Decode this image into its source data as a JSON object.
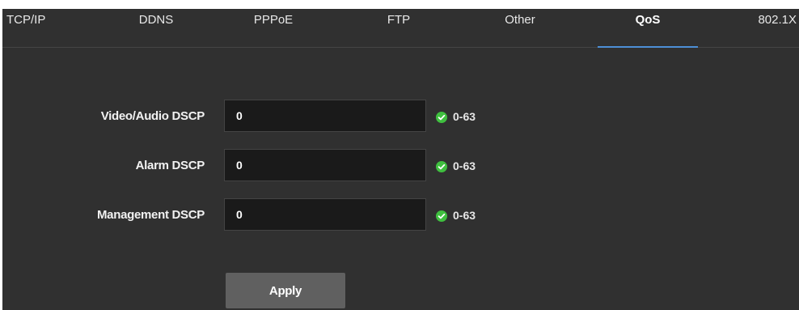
{
  "tabs": [
    {
      "label": "TCP/IP",
      "active": false
    },
    {
      "label": "DDNS",
      "active": false
    },
    {
      "label": "PPPoE",
      "active": false
    },
    {
      "label": "FTP",
      "active": false
    },
    {
      "label": "Other",
      "active": false
    },
    {
      "label": "QoS",
      "active": true
    },
    {
      "label": "802.1X",
      "active": false
    }
  ],
  "colors": {
    "accent": "#4d8fd6",
    "background": "#303030",
    "valid_icon": "#3fbf3f"
  },
  "form": {
    "fields": [
      {
        "label": "Video/Audio DSCP",
        "value": "0",
        "hint": "0-63",
        "status_icon": "check-circle-icon"
      },
      {
        "label": "Alarm DSCP",
        "value": "0",
        "hint": "0-63",
        "status_icon": "check-circle-icon"
      },
      {
        "label": "Management DSCP",
        "value": "0",
        "hint": "0-63",
        "status_icon": "check-circle-icon"
      }
    ],
    "apply_label": "Apply"
  }
}
